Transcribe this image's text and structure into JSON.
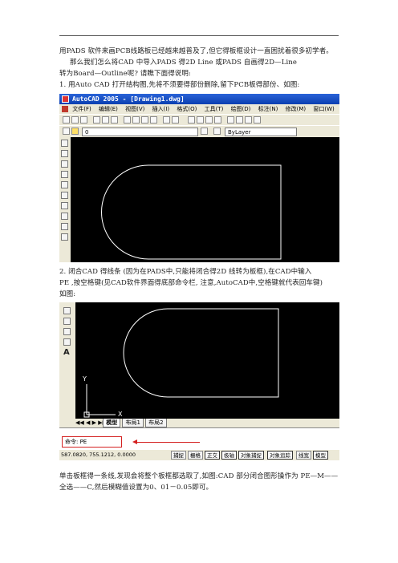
{
  "paragraphs": {
    "p1": "用PADS 软件来画PCB线路板已经越来越普及了,但它得板框设计一直困扰着很多初学者。",
    "p2": "那么我们怎么将CAD 中导入PADS 得2D Line 或PADS 自画得2D—Line",
    "p3": "转为Board—Outline呢? 请瞧下面得说明:",
    "p4": "1.  用Auto CAD 打开结构图,先将不须要得部份删除,留下PCB板得部份、如图:",
    "p5": "2. 闭合CAD 得线条 (因为在PADS中,只能将闭合得2D 线转为板框),在CAD中输入",
    "p6": "PE ,按空格键(见CAD软件界面得底部命令栏, 注意,AutoCAD中,空格键就代表回车键)",
    "p7": "如图:",
    "p8": "单击板框得一条线,发现会将整个板框都选取了,如图:CAD 部分闭合图形操作为 PE—M——",
    "p9": "全选——C,然后模糊值设置为0、01－0.05即可。"
  },
  "screenshot1": {
    "title": "AutoCAD 2005 - [Drawing1.dwg]",
    "menu": [
      "文件(F)",
      "编辑(E)",
      "视图(V)",
      "插入(I)",
      "格式(O)",
      "工具(T)",
      "绘图(D)",
      "标注(N)",
      "修改(M)",
      "窗口(W)"
    ],
    "layer_value": "0",
    "linetype_value": "ByLayer"
  },
  "screenshot2": {
    "tabs": [
      "模型",
      "布局1",
      "布局2"
    ],
    "command_text": "命令: PE",
    "coords": "587.0820, 755.1212, 0.0000",
    "status_buttons": [
      "捕捉",
      "栅格",
      "正交",
      "极轴",
      "对象捕捉",
      "对象追踪",
      "线宽",
      "模型"
    ],
    "ucs_x": "X",
    "ucs_y": "Y"
  }
}
